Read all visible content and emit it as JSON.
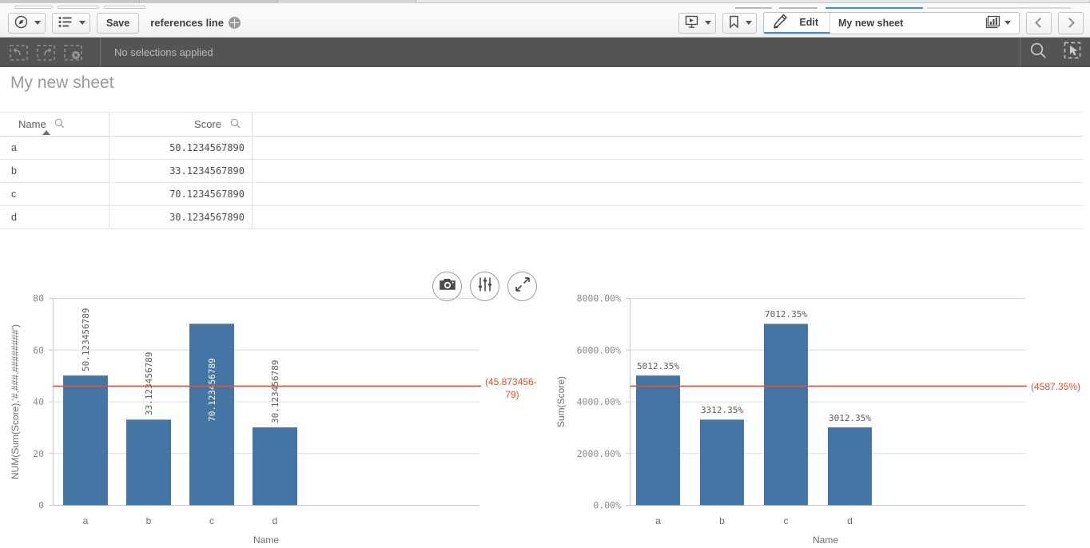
{
  "app": {
    "document_title": "references line",
    "globe_icon": "globe-icon"
  },
  "toolbar": {
    "navigation_icon": "compass-icon",
    "sheets_icon": "list-icon",
    "save_label": "Save",
    "storytelling_icon": "story-icon",
    "bookmark_icon": "bookmark-icon",
    "edit_label": "Edit",
    "edit_icon": "pencil-icon",
    "sheet_name": "My new sheet",
    "sheet_thumbnail_icon": "chart-thumbnail-icon",
    "prev_icon": "chevron-left-icon",
    "next_icon": "chevron-right-icon"
  },
  "selection_bar": {
    "back_icon": "step-back-icon",
    "forward_icon": "step-forward-icon",
    "clear_icon": "clear-selections-icon",
    "status": "No selections applied",
    "search_icon": "search-icon",
    "lasso_icon": "selection-tool-icon"
  },
  "sheet": {
    "title": "My new sheet"
  },
  "table": {
    "columns": [
      {
        "label": "Name",
        "align": "left",
        "sorted": true,
        "search_icon": "search-icon"
      },
      {
        "label": "Score",
        "align": "right",
        "sorted": false,
        "search_icon": "search-icon"
      },
      {
        "label": "",
        "align": "left",
        "sorted": false,
        "search_icon": ""
      }
    ],
    "rows": [
      {
        "name": "a",
        "score": "50.1234567890"
      },
      {
        "name": "b",
        "score": "33.1234567890"
      },
      {
        "name": "c",
        "score": "70.1234567890"
      },
      {
        "name": "d",
        "score": "30.1234567890"
      }
    ]
  },
  "hover_toolbar": {
    "buttons": [
      {
        "name": "snapshot-button",
        "icon": "camera-icon"
      },
      {
        "name": "properties-button",
        "icon": "sliders-icon"
      },
      {
        "name": "fullscreen-button",
        "icon": "expand-icon"
      }
    ]
  },
  "colors": {
    "bar": "#4575a5",
    "reference_line": "#e8502a",
    "grid": "#dcdcdc",
    "selection_bar": "#545454",
    "toolbar": "#f2f2f2",
    "accent": "#3b93d4"
  },
  "chart_data": [
    {
      "type": "bar",
      "name": "left-bar-chart",
      "title": "",
      "xlabel": "Name",
      "ylabel": "NUM(Sum(Score),'#,###.########')",
      "categories": [
        "a",
        "b",
        "c",
        "d"
      ],
      "values": [
        50.123456789,
        33.123456789,
        70.123456789,
        30.123456789
      ],
      "value_labels": [
        "50.123456789",
        "33.123456789",
        "70.123456789",
        "30.123456789"
      ],
      "value_label_rotation": -90,
      "value_label_placement": [
        "outside",
        "outside",
        "inside",
        "outside"
      ],
      "ylim": [
        0,
        80
      ],
      "yticks": [
        0,
        20,
        40,
        60,
        80
      ],
      "ytick_labels": [
        "0",
        "20",
        "40",
        "60",
        "80"
      ],
      "grid": true,
      "legend": "none",
      "reference_lines": [
        {
          "value": 45.87345679,
          "label": "(45.873456-79)",
          "label_lines": [
            "(45.873456-",
            "79)"
          ],
          "color": "#e8502a"
        }
      ]
    },
    {
      "type": "bar",
      "name": "right-bar-chart",
      "title": "",
      "xlabel": "Name",
      "ylabel": "Sum(Score)",
      "categories": [
        "a",
        "b",
        "c",
        "d"
      ],
      "values": [
        5012.35,
        3312.35,
        7012.35,
        3012.35
      ],
      "value_labels": [
        "5012.35%",
        "3312.35%",
        "7012.35%",
        "3012.35%"
      ],
      "value_label_rotation": 0,
      "value_label_placement": [
        "outside",
        "outside",
        "outside",
        "outside"
      ],
      "ylim": [
        0,
        8000
      ],
      "yticks": [
        0,
        2000,
        4000,
        6000,
        8000
      ],
      "ytick_labels": [
        "0.00%",
        "2000.00%",
        "4000.00%",
        "6000.00%",
        "8000.00%"
      ],
      "grid": true,
      "legend": "none",
      "reference_lines": [
        {
          "value": 4587.35,
          "label": "(4587.35%)",
          "label_lines": [
            "(4587.35%)"
          ],
          "color": "#e8502a"
        }
      ]
    }
  ]
}
